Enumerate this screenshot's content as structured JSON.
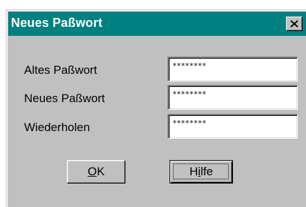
{
  "dialog": {
    "title": "Neues Paßwort",
    "close_icon": "close-icon"
  },
  "fields": [
    {
      "label": "Altes Paßwort",
      "value": "********"
    },
    {
      "label": "Neues Paßwort",
      "value": "********"
    },
    {
      "label": "Wiederholen",
      "value": "********"
    }
  ],
  "buttons": {
    "ok": {
      "mnemonic": "O",
      "rest": "K"
    },
    "help": {
      "pre": "H",
      "mnemonic": "i",
      "rest": "lfe"
    }
  },
  "colors": {
    "titlebar": "#008080",
    "dialog_face": "#c0c0c0",
    "field_background": "#ffffff"
  }
}
